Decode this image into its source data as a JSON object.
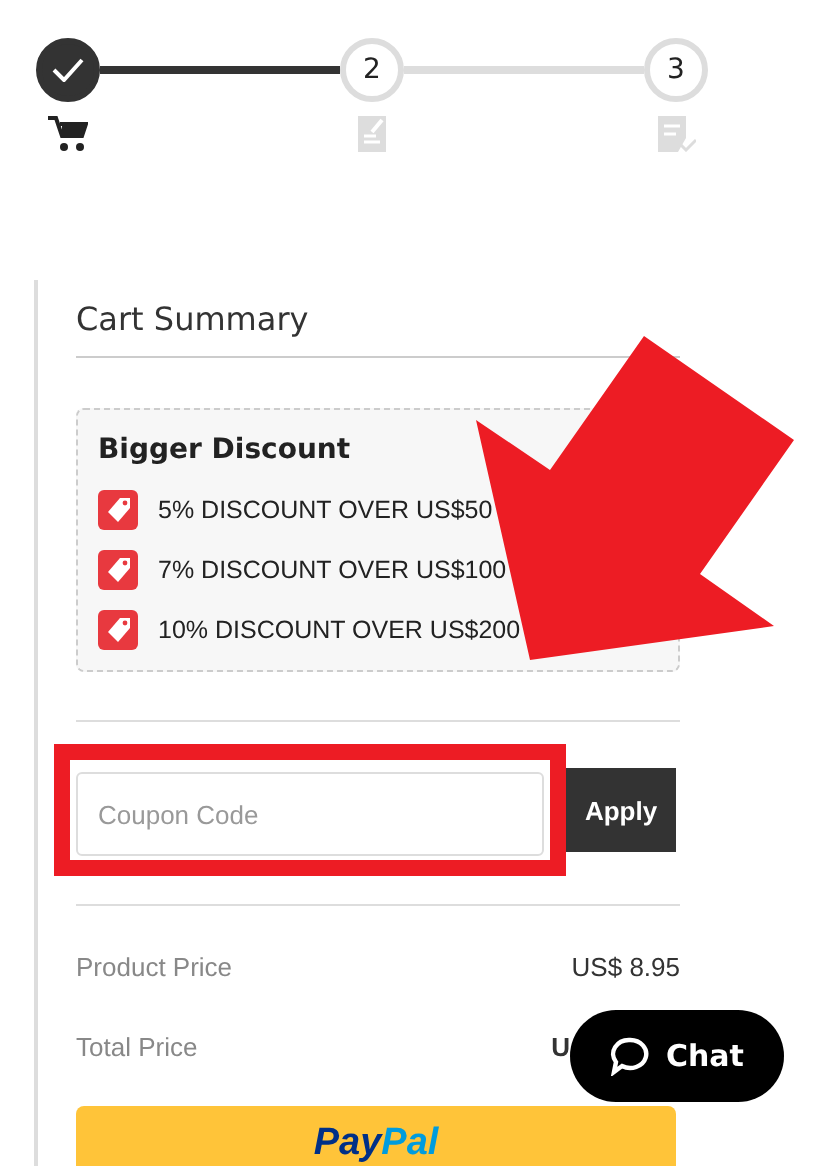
{
  "steps": [
    {
      "completed": true
    },
    {
      "number": "2",
      "completed": false
    },
    {
      "number": "3",
      "completed": false
    }
  ],
  "summary": {
    "title": "Cart Summary",
    "discount": {
      "title": "Bigger Discount",
      "items": [
        "5% DISCOUNT OVER US$50",
        "7% DISCOUNT OVER US$100",
        "10% DISCOUNT OVER US$200"
      ]
    },
    "coupon": {
      "placeholder": "Coupon Code",
      "button": "Apply"
    },
    "prices": [
      {
        "label": "Product Price",
        "value": "US$ 8.95"
      },
      {
        "label": "Total Price",
        "value": "U"
      }
    ],
    "paypal": [
      "Pay",
      "Pal"
    ]
  },
  "chat": {
    "label": "Chat"
  }
}
